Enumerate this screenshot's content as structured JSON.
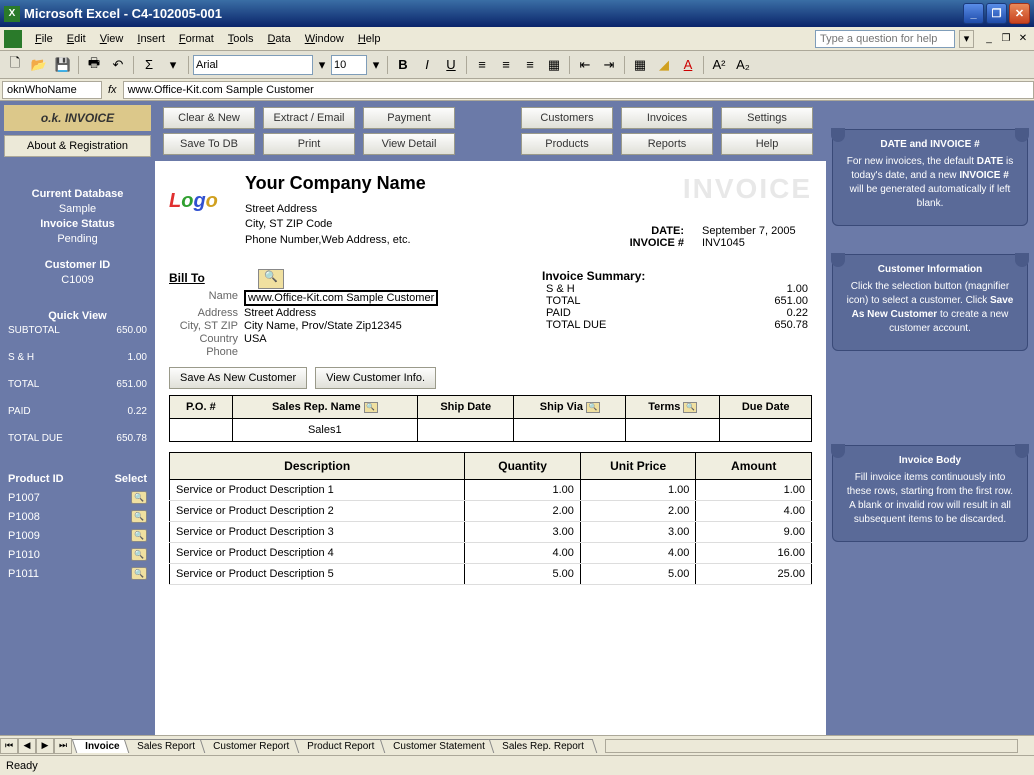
{
  "window": {
    "title": "Microsoft Excel - C4-102005-001"
  },
  "menus": [
    "File",
    "Edit",
    "View",
    "Insert",
    "Format",
    "Tools",
    "Data",
    "Window",
    "Help"
  ],
  "help_placeholder": "Type a question for help",
  "toolbar": {
    "font_name": "Arial",
    "font_size": "10"
  },
  "formulabar": {
    "namebox": "oknWhoName",
    "formula": "www.Office-Kit.com Sample Customer"
  },
  "left": {
    "logo": "o.k. INVOICE",
    "about": "About & Registration",
    "db_label": "Current Database",
    "db_value": "Sample",
    "status_label": "Invoice Status",
    "status_value": "Pending",
    "cust_label": "Customer ID",
    "cust_value": "C1009",
    "quick_label": "Quick View",
    "quick": [
      {
        "k": "SUBTOTAL",
        "v": "650.00"
      },
      {
        "k": "S & H",
        "v": "1.00"
      },
      {
        "k": "TOTAL",
        "v": "651.00"
      },
      {
        "k": "PAID",
        "v": "0.22"
      },
      {
        "k": "TOTAL DUE",
        "v": "650.78"
      }
    ],
    "prod_id_label": "Product ID",
    "select_label": "Select",
    "products": [
      "P1007",
      "P1008",
      "P1009",
      "P1010",
      "P1011"
    ]
  },
  "buttons": {
    "row1": [
      "Clear & New",
      "Extract / Email",
      "Payment",
      "",
      "Customers",
      "Invoices",
      "Settings"
    ],
    "row2": [
      "Save To DB",
      "Print",
      "View Detail",
      "",
      "Products",
      "Reports",
      "Help"
    ]
  },
  "company": {
    "name": "Your Company Name",
    "addr1": "Street Address",
    "addr2": "City, ST  ZIP Code",
    "addr3": "Phone Number,Web Address, etc."
  },
  "invoice": {
    "word": "INVOICE",
    "date_label": "DATE:",
    "date_value": "September 7, 2005",
    "num_label": "INVOICE #",
    "num_value": "INV1045"
  },
  "billto": {
    "title": "Bill To",
    "rows": [
      {
        "lbl": "Name",
        "val": "www.Office-Kit.com Sample Customer"
      },
      {
        "lbl": "Address",
        "val": "Street Address"
      },
      {
        "lbl": "City, ST ZIP",
        "val": "City Name, Prov/State Zip12345"
      },
      {
        "lbl": "Country",
        "val": "USA"
      },
      {
        "lbl": "Phone",
        "val": ""
      }
    ]
  },
  "summary": {
    "title": "Invoice Summary:",
    "rows": [
      {
        "k": "S & H",
        "v": "1.00"
      },
      {
        "k": "TOTAL",
        "v": "651.00"
      },
      {
        "k": "PAID",
        "v": "0.22"
      },
      {
        "k": "TOTAL DUE",
        "v": "650.78"
      }
    ]
  },
  "cust_buttons": {
    "save": "Save As New Customer",
    "view": "View Customer Info."
  },
  "order_headers": [
    "P.O. #",
    "Sales Rep. Name",
    "Ship Date",
    "Ship Via",
    "Terms",
    "Due Date"
  ],
  "order_row": [
    "",
    "Sales1",
    "",
    "",
    "",
    ""
  ],
  "item_headers": [
    "Description",
    "Quantity",
    "Unit Price",
    "Amount"
  ],
  "items": [
    {
      "d": "Service or Product Description 1",
      "q": "1.00",
      "p": "1.00",
      "a": "1.00"
    },
    {
      "d": "Service or Product Description 2",
      "q": "2.00",
      "p": "2.00",
      "a": "4.00"
    },
    {
      "d": "Service or Product Description 3",
      "q": "3.00",
      "p": "3.00",
      "a": "9.00"
    },
    {
      "d": "Service or Product Description 4",
      "q": "4.00",
      "p": "4.00",
      "a": "16.00"
    },
    {
      "d": "Service or Product Description 5",
      "q": "5.00",
      "p": "5.00",
      "a": "25.00"
    }
  ],
  "help_cards": [
    {
      "title": "DATE and INVOICE #",
      "body": "For new invoices, the default <b>DATE</b> is today's date, and a new <b>INVOICE #</b> will be generated automatically if left blank."
    },
    {
      "title": "Customer Information",
      "body": "Click the selection button (magnifier icon) to select a customer. Click <b>Save As New Customer</b> to create a new customer account."
    },
    {
      "title": "Invoice Body",
      "body": "Fill invoice items continuously into these rows, starting from the first row. A blank or invalid row will result in all subsequent items to be discarded."
    }
  ],
  "tabs": [
    "Invoice",
    "Sales Report",
    "Customer Report",
    "Product Report",
    "Customer Statement",
    "Sales Rep. Report"
  ],
  "status": "Ready"
}
